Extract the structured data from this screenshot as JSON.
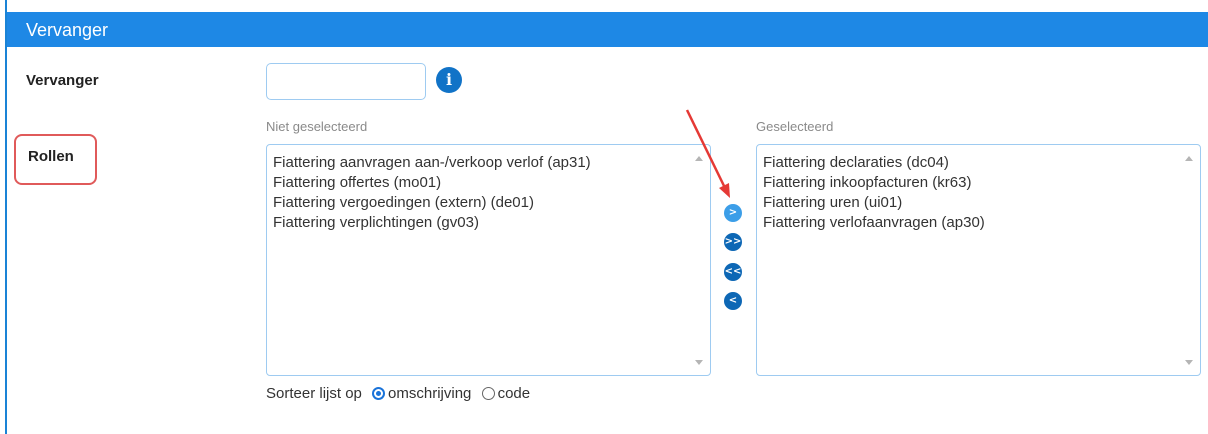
{
  "header": {
    "title": "Vervanger"
  },
  "form": {
    "vervanger_label": "Vervanger",
    "vervanger_value": "",
    "rollen_label": "Rollen"
  },
  "left_list": {
    "caption": "Niet geselecteerd",
    "items": [
      "Fiattering aanvragen aan-/verkoop verlof (ap31)",
      "Fiattering offertes (mo01)",
      "Fiattering vergoedingen (extern) (de01)",
      "Fiattering verplichtingen (gv03)"
    ]
  },
  "right_list": {
    "caption": "Geselecteerd",
    "items": [
      "Fiattering declaraties (dc04)",
      "Fiattering inkoopfacturen (kr63)",
      "Fiattering uren (ui01)",
      "Fiattering verlofaanvragen (ap30)"
    ]
  },
  "move_buttons": {
    "add": ">",
    "add_all": ">>",
    "remove_all": "<<",
    "remove": "<"
  },
  "info_icon_glyph": "i",
  "sort": {
    "label": "Sorteer lijst op",
    "options": [
      "omschrijving",
      "code"
    ],
    "selected": "omschrijving"
  },
  "colors": {
    "header": "#1e88e5",
    "accent": "#1173c7",
    "highlight": "#e05a5a"
  }
}
